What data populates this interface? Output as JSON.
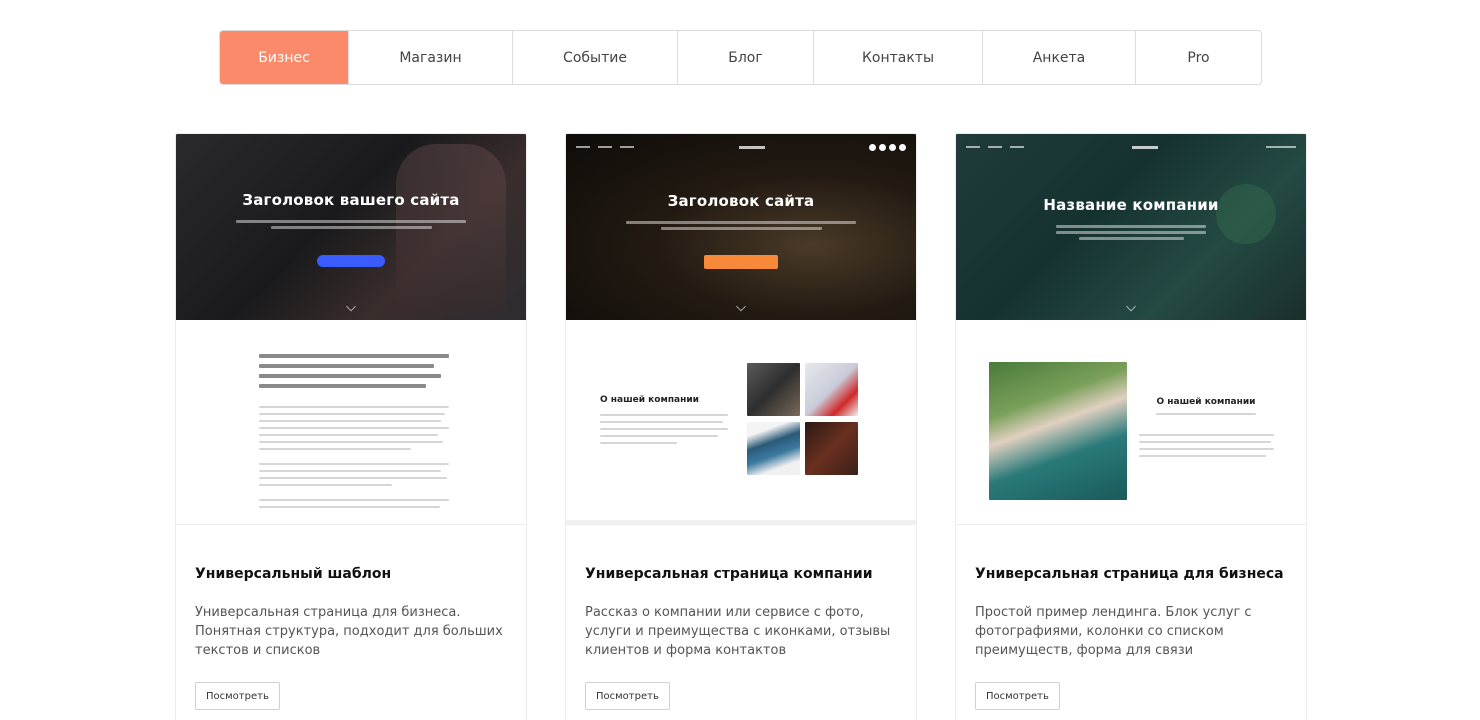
{
  "tabs": [
    {
      "label": "Бизнес",
      "active": true
    },
    {
      "label": "Магазин",
      "active": false
    },
    {
      "label": "Событие",
      "active": false
    },
    {
      "label": "Блог",
      "active": false
    },
    {
      "label": "Контакты",
      "active": false
    },
    {
      "label": "Анкета",
      "active": false
    },
    {
      "label": "Pro",
      "active": false
    }
  ],
  "colors": {
    "accent": "#fb8a6a",
    "cta_blue": "#3a5cff",
    "cta_orange": "#f7893a"
  },
  "cards": [
    {
      "preview_title": "Заголовок вашего сайта",
      "title": "Универсальный шаблон",
      "description": "Универсальная страница для бизнеса. Понятная структура, подходит для больших текстов и списков",
      "button": "Посмотреть"
    },
    {
      "preview_title": "Заголовок сайта",
      "preview_logo": "логотип",
      "preview_section": "О нашей компании",
      "title": "Универсальная страница компании",
      "description": "Рассказ о компании или сервисе с фото, услуги и преимущества с иконками, отзывы клиентов и форма контактов",
      "button": "Посмотреть"
    },
    {
      "preview_title": "Название компании",
      "preview_section": "О нашей компании",
      "title": "Универсальная страница для бизнеса",
      "description": "Простой пример лендинга. Блок услуг с фотографиями, колонки со списком преимуществ, форма для связи",
      "button": "Посмотреть"
    }
  ]
}
